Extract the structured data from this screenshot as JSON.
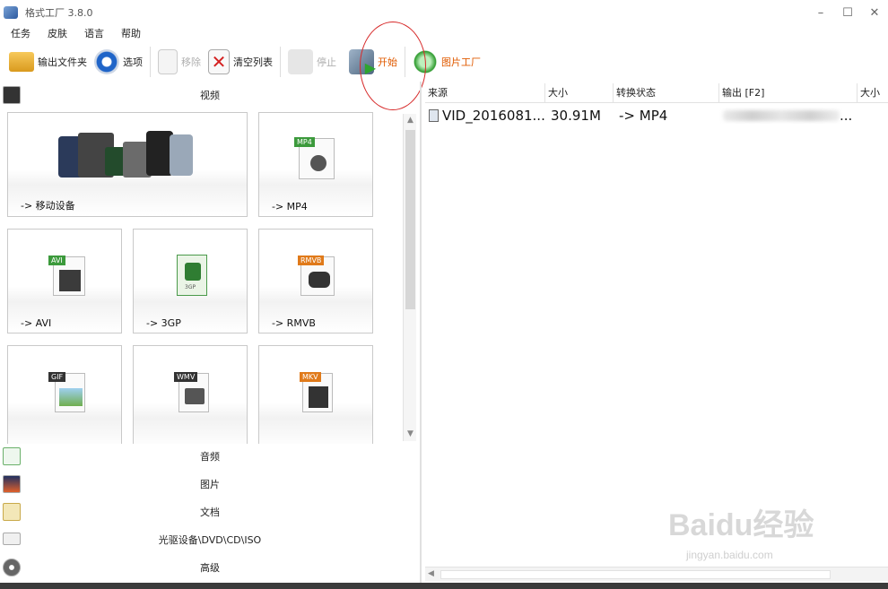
{
  "window": {
    "title": "格式工厂 3.8.0",
    "minimize": "–",
    "maximize": "☐",
    "close": "✕"
  },
  "menu": [
    "任务",
    "皮肤",
    "语言",
    "帮助"
  ],
  "toolbar": {
    "output_folder": "输出文件夹",
    "options": "选项",
    "remove": "移除",
    "clear_list": "清空列表",
    "stop": "停止",
    "start": "开始",
    "picture_factory": "图片工厂"
  },
  "categories": {
    "video": "视频",
    "audio": "音频",
    "picture": "图片",
    "document": "文档",
    "optical": "光驱设备\\DVD\\CD\\ISO",
    "advanced": "高级"
  },
  "tiles": [
    {
      "label": "-> 移动设备",
      "icon": "mobile-devices-icon"
    },
    {
      "label": "-> MP4",
      "icon": "mp4-file-icon",
      "badge": "MP4"
    },
    {
      "label": "-> AVI",
      "icon": "avi-file-icon",
      "badge": "AVI"
    },
    {
      "label": "-> 3GP",
      "icon": "3gp-file-icon",
      "badge": "3GP"
    },
    {
      "label": "-> RMVB",
      "icon": "rmvb-file-icon",
      "badge": "RMVB"
    },
    {
      "label": "",
      "icon": "gif-file-icon",
      "badge": "GIF"
    },
    {
      "label": "",
      "icon": "wmv-file-icon",
      "badge": "WMV"
    },
    {
      "label": "",
      "icon": "mkv-file-icon",
      "badge": "MKV"
    }
  ],
  "list": {
    "columns": [
      "来源",
      "大小",
      "转换状态",
      "输出 [F2]",
      "大小"
    ],
    "rows": [
      {
        "source": "VID_2016081...",
        "size": "30.91M",
        "status": "-> MP4",
        "output": "...",
        "out_size": ""
      }
    ]
  },
  "watermark": {
    "main": "Baidu经验",
    "sub": "jingyan.baidu.com"
  },
  "colors": {
    "accent_orange": "#e05a00",
    "circle": "#d72a2a",
    "badge_green": "#3c9a3c",
    "badge_orange": "#e07a1a",
    "badge_dark": "#333333"
  }
}
